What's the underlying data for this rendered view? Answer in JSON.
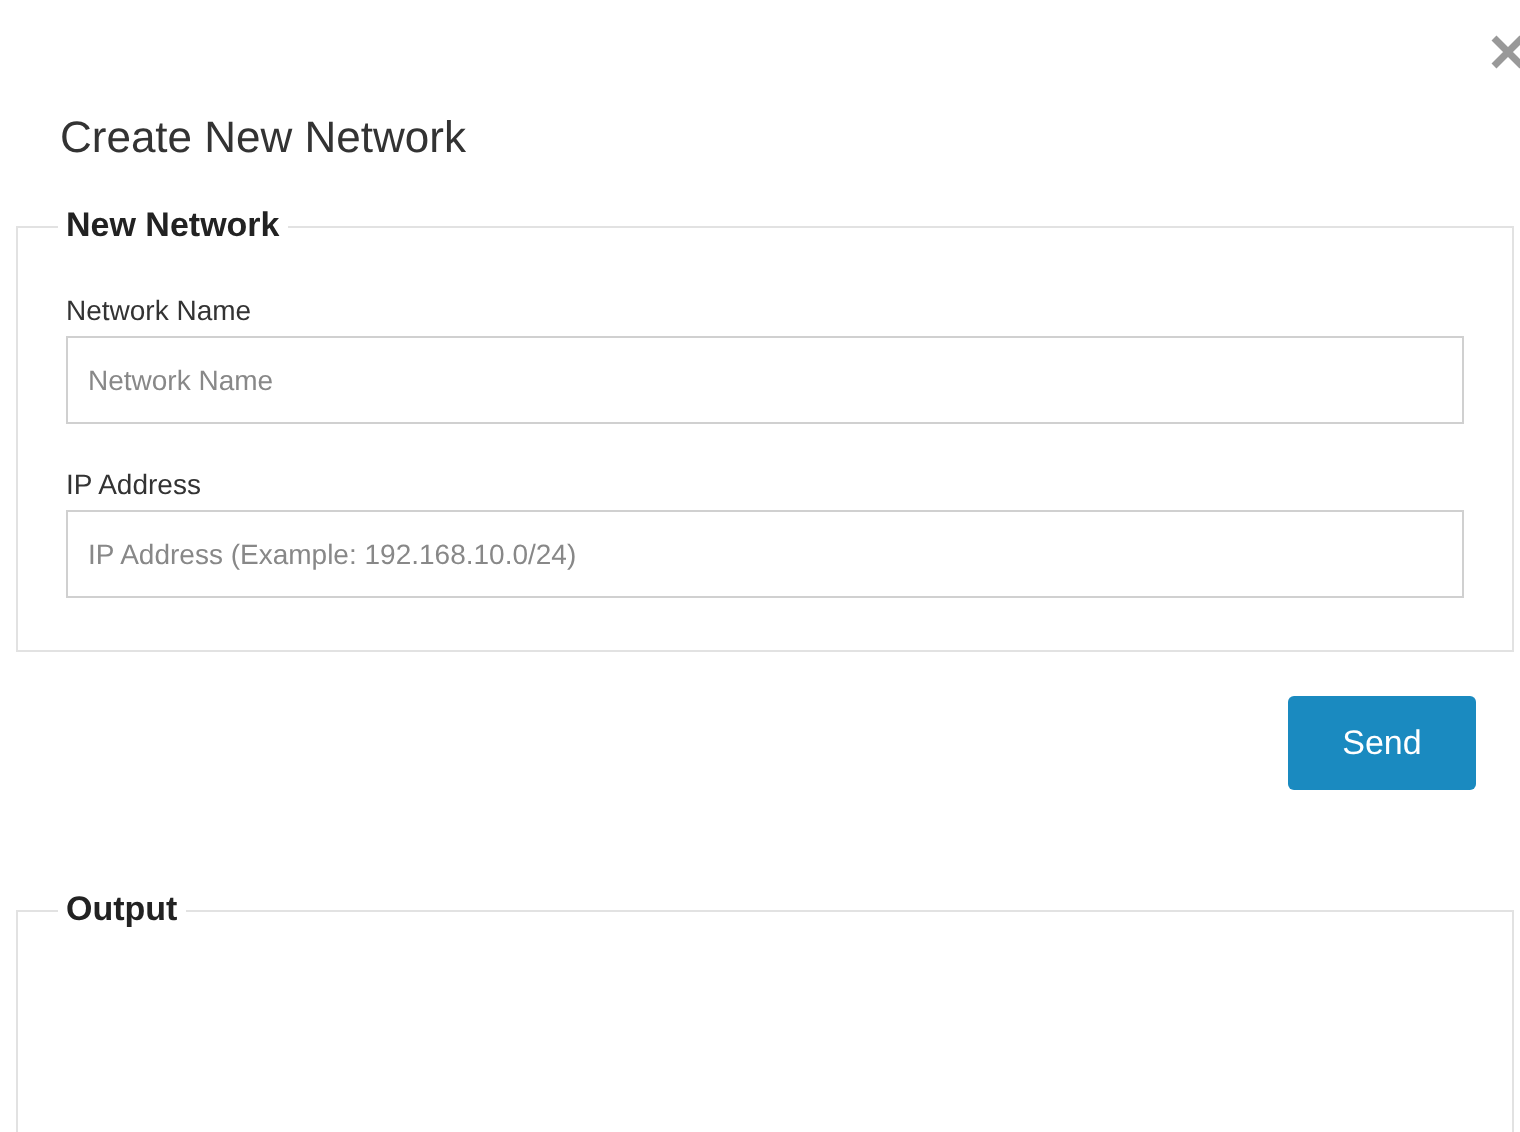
{
  "dialog": {
    "title": "Create New Network"
  },
  "form": {
    "legend": "New Network",
    "fields": [
      {
        "label": "Network Name",
        "placeholder": "Network Name"
      },
      {
        "label": "IP Address",
        "placeholder": "IP Address (Example: 192.168.10.0/24)"
      }
    ]
  },
  "submit": {
    "label": "Send"
  },
  "output": {
    "legend": "Output"
  }
}
